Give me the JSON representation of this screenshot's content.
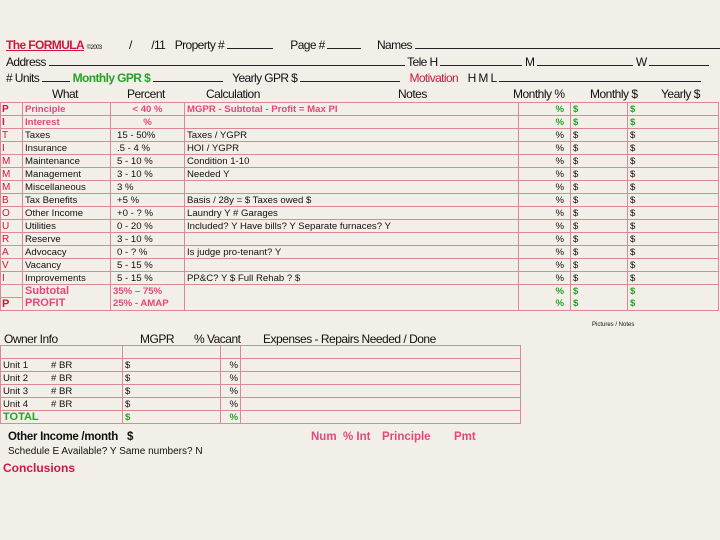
{
  "header": {
    "title": "The FORMULA",
    "copyright": "©2003",
    "slash1": "/",
    "date_suffix": "/11",
    "property_label": "Property #",
    "page_label": "Page #",
    "names_label": "Names",
    "address_label": "Address",
    "tele_h": "Tele H",
    "tele_m": "M",
    "tele_w": "W",
    "units_label": "# Units",
    "monthly_gpr_label": "Monthly GPR $",
    "yearly_gpr_label": "Yearly GPR $",
    "motivation_label": "Motivation",
    "hml": "H M L"
  },
  "columns": {
    "what": "What",
    "percent": "Percent",
    "calculation": "Calculation",
    "notes": "Notes",
    "monthly_pct": "Monthly %",
    "monthly_dollar": "Monthly $",
    "yearly_dollar": "Yearly $"
  },
  "rows": [
    {
      "letter": "P",
      "what": "Principle",
      "percent": "< 40 %",
      "calc": "MGPR - Subtotal - Profit = Max PI",
      "m_pct": "%",
      "m_dol": "$",
      "y_dol": "$"
    },
    {
      "letter": "I",
      "what": "Interest",
      "percent": "%",
      "calc": "",
      "m_pct": "%",
      "m_dol": "$",
      "y_dol": "$"
    },
    {
      "letter": "T",
      "what": "Taxes",
      "percent": "15 - 50%",
      "calc": "Taxes / YGPR",
      "m_pct": "%",
      "m_dol": "$",
      "y_dol": "$"
    },
    {
      "letter": "I",
      "what": "Insurance",
      "percent": ".5 - 4   %",
      "calc": "HOI / YGPR",
      "m_pct": "%",
      "m_dol": "$",
      "y_dol": "$"
    },
    {
      "letter": "M",
      "what": "Maintenance",
      "percent": "5 - 10   %",
      "calc": "Condition 1-10",
      "m_pct": "%",
      "m_dol": "$",
      "y_dol": "$"
    },
    {
      "letter": "M",
      "what": "Management",
      "percent": "3 - 10 %",
      "calc": "Needed   Y",
      "m_pct": "%",
      "m_dol": "$",
      "y_dol": "$"
    },
    {
      "letter": "M",
      "what": "Miscellaneous",
      "percent": "3      %",
      "calc": "",
      "m_pct": "%",
      "m_dol": "$",
      "y_dol": "$"
    },
    {
      "letter": "B",
      "what": "Tax Benefits",
      "percent": "+5      %",
      "calc": "Basis / 28y = $          Taxes owed $",
      "m_pct": "%",
      "m_dol": "$",
      "y_dol": "$"
    },
    {
      "letter": "O",
      "what": "Other Income",
      "percent": "+0 -  ? %",
      "calc": "Laundry   Y     # Garages",
      "m_pct": "%",
      "m_dol": "$",
      "y_dol": "$"
    },
    {
      "letter": "U",
      "what": "Utilities",
      "percent": "0 - 20 %",
      "calc": "Included?   Y     Have bills?   Y     Separate furnaces?   Y",
      "m_pct": "%",
      "m_dol": "$",
      "y_dol": "$"
    },
    {
      "letter": "R",
      "what": "Reserve",
      "percent": "3 - 10 %",
      "calc": "",
      "m_pct": "%",
      "m_dol": "$",
      "y_dol": "$"
    },
    {
      "letter": "A",
      "what": "Advocacy",
      "percent": "0  -  ?  %",
      "calc": "Is judge pro-tenant?   Y",
      "m_pct": "%",
      "m_dol": "$",
      "y_dol": "$"
    },
    {
      "letter": "V",
      "what": "Vacancy",
      "percent": "5 - 15 %",
      "calc": "",
      "m_pct": "%",
      "m_dol": "$",
      "y_dol": "$"
    },
    {
      "letter": "I",
      "what": "Improvements",
      "percent": "5 - 15 %",
      "calc": "PP&C?   Y    $                    Full Rehab ?  $",
      "m_pct": "%",
      "m_dol": "$",
      "y_dol": "$"
    }
  ],
  "subtotal": {
    "label": "Subtotal",
    "percent": "35%  –  75%",
    "m_pct": "%",
    "m_dol": "$",
    "y_dol": "$"
  },
  "profit": {
    "letter": "P",
    "label": "PROFIT",
    "percent": "25% - AMAP",
    "m_pct": "%",
    "m_dol": "$",
    "y_dol": "$"
  },
  "pictures_notes": "Pictures / Notes",
  "owner": {
    "owner_info": "Owner Info",
    "mgpr": "MGPR",
    "pct_vacant": "% Vacant",
    "expenses": "Expenses  -  Repairs Needed / Done",
    "units": [
      {
        "unit": "Unit 1",
        "br": "# BR",
        "dol": "$",
        "pct": "%"
      },
      {
        "unit": "Unit 2",
        "br": "# BR",
        "dol": "$",
        "pct": "%"
      },
      {
        "unit": "Unit 3",
        "br": "# BR",
        "dol": "$",
        "pct": "%"
      },
      {
        "unit": "Unit 4",
        "br": "# BR",
        "dol": "$",
        "pct": "%"
      }
    ],
    "total": "TOTAL",
    "total_dol": "$",
    "total_pct": "%"
  },
  "other_income": {
    "label": "Other Income /month",
    "dol": "$",
    "num": "Num",
    "pct_int": "% Int",
    "principle": "Principle",
    "pmt": "Pmt"
  },
  "schedule_e": "Schedule E Available?   Y      Same numbers?   N",
  "conclusions": "Conclusions",
  "colors": {
    "red": "#d2173f",
    "pink": "#e8467a",
    "green": "#23a326",
    "grid": "#dd8895"
  }
}
